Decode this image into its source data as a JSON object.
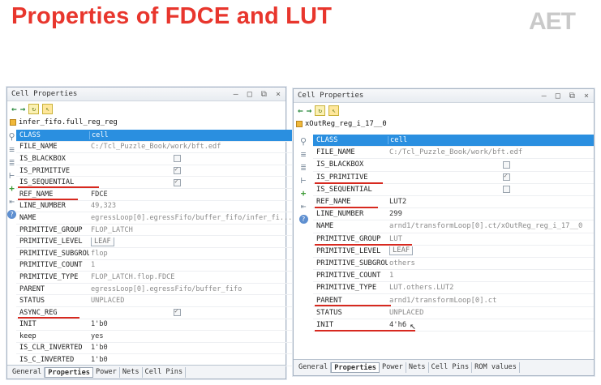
{
  "slide": {
    "title": "Properties of FDCE and LUT",
    "logo": "AET",
    "underline_color": "#d7291f"
  },
  "left": {
    "window_title": "Cell Properties",
    "object": "infer_fifo.full_reg_reg",
    "rows": [
      {
        "key": "CLASS",
        "value": "cell"
      },
      {
        "key": "FILE_NAME",
        "value": "C:/Tcl_Puzzle_Book/work/bft.edf"
      },
      {
        "key": "IS_BLACKBOX",
        "value": ""
      },
      {
        "key": "IS_PRIMITIVE",
        "value": ""
      },
      {
        "key": "IS_SEQUENTIAL",
        "value": ""
      },
      {
        "key": "REF_NAME",
        "value": "FDCE"
      },
      {
        "key": "LINE_NUMBER",
        "value": "49,323"
      },
      {
        "key": "NAME",
        "value": "egressLoop[0].egressFifo/buffer_fifo/infer_fi..."
      },
      {
        "key": "PRIMITIVE_GROUP",
        "value": "FLOP_LATCH"
      },
      {
        "key": "PRIMITIVE_LEVEL",
        "value": "LEAF"
      },
      {
        "key": "PRIMITIVE_SUBGROUP",
        "value": "flop"
      },
      {
        "key": "PRIMITIVE_COUNT",
        "value": "1"
      },
      {
        "key": "PRIMITIVE_TYPE",
        "value": "FLOP_LATCH.flop.FDCE"
      },
      {
        "key": "PARENT",
        "value": "egressLoop[0].egressFifo/buffer_fifo"
      },
      {
        "key": "STATUS",
        "value": "UNPLACED"
      },
      {
        "key": "ASYNC_REG",
        "value": ""
      },
      {
        "key": "INIT",
        "value": "1'b0"
      },
      {
        "key": "keep",
        "value": "yes"
      },
      {
        "key": "IS_CLR_INVERTED",
        "value": "1'b0"
      },
      {
        "key": "IS_C_INVERTED",
        "value": "1'b0"
      }
    ],
    "tabs": [
      "General",
      "Properties",
      "Power",
      "Nets",
      "Cell Pins"
    ]
  },
  "right": {
    "window_title": "Cell Properties",
    "object": "xOutReg_reg_i_17__0",
    "rows": [
      {
        "key": "CLASS",
        "value": "cell"
      },
      {
        "key": "FILE_NAME",
        "value": "C:/Tcl_Puzzle_Book/work/bft.edf"
      },
      {
        "key": "IS_BLACKBOX",
        "value": ""
      },
      {
        "key": "IS_PRIMITIVE",
        "value": ""
      },
      {
        "key": "IS_SEQUENTIAL",
        "value": ""
      },
      {
        "key": "REF_NAME",
        "value": "LUT2"
      },
      {
        "key": "LINE_NUMBER",
        "value": "299"
      },
      {
        "key": "NAME",
        "value": "arnd1/transformLoop[0].ct/xOutReg_reg_i_17__0"
      },
      {
        "key": "PRIMITIVE_GROUP",
        "value": "LUT"
      },
      {
        "key": "PRIMITIVE_LEVEL",
        "value": "LEAF"
      },
      {
        "key": "PRIMITIVE_SUBGROUP",
        "value": "others"
      },
      {
        "key": "PRIMITIVE_COUNT",
        "value": "1"
      },
      {
        "key": "PRIMITIVE_TYPE",
        "value": "LUT.others.LUT2"
      },
      {
        "key": "PARENT",
        "value": "arnd1/transformLoop[0].ct"
      },
      {
        "key": "STATUS",
        "value": "UNPLACED"
      },
      {
        "key": "INIT",
        "value": "4'h6"
      }
    ],
    "tabs": [
      "General",
      "Properties",
      "Power",
      "Nets",
      "Cell Pins",
      "ROM values"
    ]
  }
}
